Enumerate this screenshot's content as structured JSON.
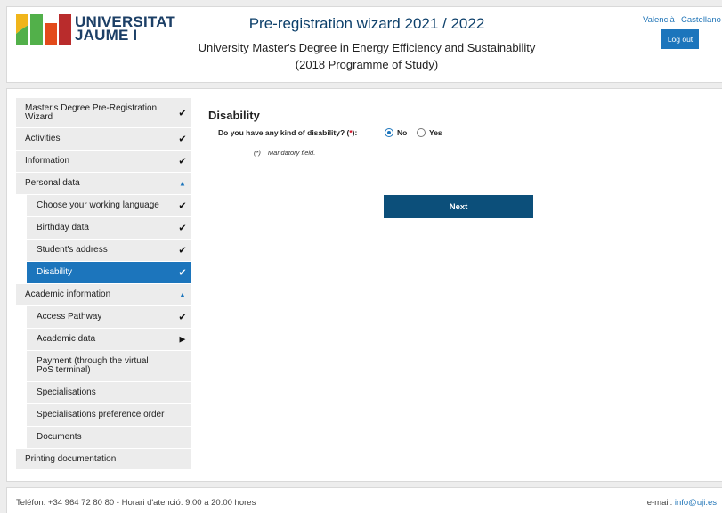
{
  "header": {
    "logo_text_line1": "UNIVERSITAT",
    "logo_text_line2": "JAUME I",
    "title": "Pre-registration wizard 2021 / 2022",
    "subtitle_line1": "University Master's Degree in Energy Efficiency and Sustainability",
    "subtitle_line2": "(2018 Programme of Study)",
    "lang_valencia": "Valencià",
    "lang_castellano": "Castellano",
    "logout_label": "Log out",
    "logo_colors": [
      "#f0b51b",
      "#52b04a",
      "#e34a1b",
      "#b92c2c"
    ]
  },
  "sidebar": {
    "items": [
      {
        "label": "Master's Degree Pre-Registration Wizard",
        "level": "top",
        "status": "check",
        "icon": "check-icon"
      },
      {
        "label": "Activities",
        "level": "top",
        "status": "check",
        "icon": "check-icon"
      },
      {
        "label": "Information",
        "level": "top",
        "status": "check",
        "icon": "check-icon"
      },
      {
        "label": "Personal data",
        "level": "top",
        "status": "expanded",
        "icon": "caret-up-icon"
      },
      {
        "label": "Choose your working language",
        "level": "sub",
        "status": "check",
        "icon": "check-icon"
      },
      {
        "label": "Birthday data",
        "level": "sub",
        "status": "check",
        "icon": "check-icon"
      },
      {
        "label": "Student's address",
        "level": "sub",
        "status": "check",
        "icon": "check-icon"
      },
      {
        "label": "Disability",
        "level": "sub",
        "status": "check",
        "icon": "check-icon",
        "active": true
      },
      {
        "label": "Academic information",
        "level": "top",
        "status": "expanded",
        "icon": "caret-up-icon"
      },
      {
        "label": "Access Pathway",
        "level": "sub",
        "status": "check",
        "icon": "check-icon"
      },
      {
        "label": "Academic data",
        "level": "sub",
        "status": "current",
        "icon": "play-icon"
      },
      {
        "label": "Payment (through the virtual PoS terminal)",
        "level": "sub",
        "status": "none",
        "icon": ""
      },
      {
        "label": "Specialisations",
        "level": "sub",
        "status": "none",
        "icon": ""
      },
      {
        "label": "Specialisations preference order",
        "level": "sub",
        "status": "none",
        "icon": ""
      },
      {
        "label": "Documents",
        "level": "sub",
        "status": "none",
        "icon": ""
      },
      {
        "label": "Printing documentation",
        "level": "top",
        "status": "none",
        "icon": ""
      }
    ]
  },
  "content": {
    "section_title": "Disability",
    "question_label": "Do you have any kind of disability? (",
    "question_required_mark": "*",
    "question_label_end": "):",
    "options": [
      {
        "label": "No",
        "selected": true
      },
      {
        "label": "Yes",
        "selected": false
      }
    ],
    "mandatory_asterisk": "(*)",
    "mandatory_text": "Mandatory field.",
    "next_label": "Next"
  },
  "footer": {
    "contact": "Teléfon: +34 964 72 80 80 - Horari d'atenció: 9:00 a 20:00 hores",
    "email_prefix": "e-mail: ",
    "email": "info@uji.es"
  }
}
